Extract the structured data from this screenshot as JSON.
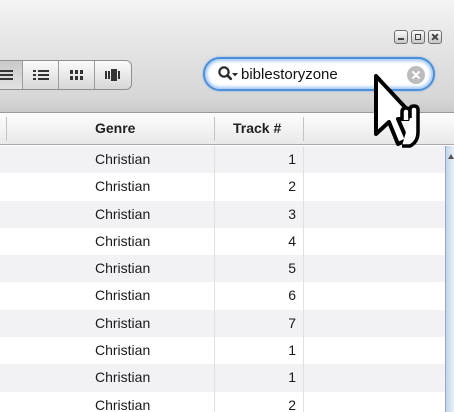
{
  "toolbar": {
    "view_buttons": [
      {
        "name": "view-list-icon",
        "active": true
      },
      {
        "name": "view-list-detail-icon",
        "active": false
      },
      {
        "name": "view-grid-icon",
        "active": false
      },
      {
        "name": "view-coverflow-icon",
        "active": false
      }
    ],
    "window_controls": [
      "minimize-icon",
      "maximize-icon",
      "close-icon"
    ]
  },
  "search": {
    "value": "biblestoryzone",
    "icon": "search-icon",
    "clear_icon": "clear-search-icon"
  },
  "table": {
    "headers": {
      "genre": "Genre",
      "track": "Track #"
    },
    "rows": [
      {
        "genre": "Christian",
        "track": "1"
      },
      {
        "genre": "Christian",
        "track": "2"
      },
      {
        "genre": "Christian",
        "track": "3"
      },
      {
        "genre": "Christian",
        "track": "4"
      },
      {
        "genre": "Christian",
        "track": "5"
      },
      {
        "genre": "Christian",
        "track": "6"
      },
      {
        "genre": "Christian",
        "track": "7"
      },
      {
        "genre": "Christian",
        "track": "1"
      },
      {
        "genre": "Christian",
        "track": "1"
      },
      {
        "genre": "Christian",
        "track": "2"
      }
    ]
  },
  "colors": {
    "search_focus": "#4e8fd8",
    "row_alt": "#f2f2f5",
    "scrollbar": "#c3d4ea"
  }
}
